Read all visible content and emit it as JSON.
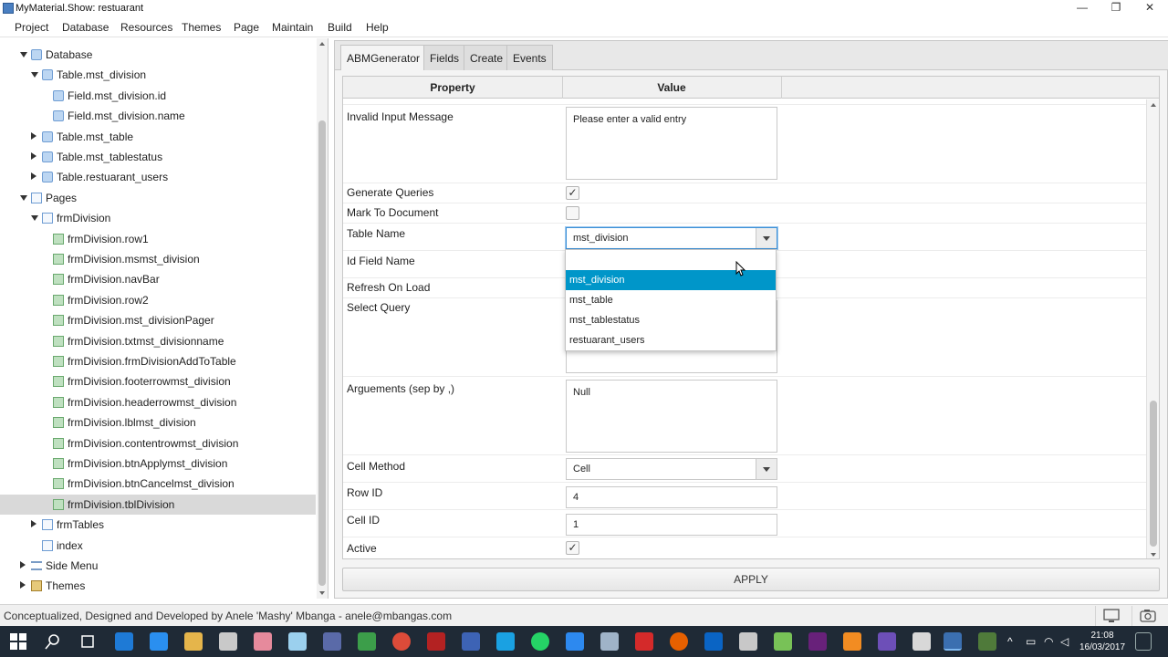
{
  "window": {
    "title": "MyMaterial.Show: restuarant",
    "minimize": "—",
    "maximize": "❐",
    "close": "✕"
  },
  "menu": [
    "Project",
    "Database",
    "Resources",
    "Themes",
    "Page",
    "Maintain",
    "Build",
    "Help"
  ],
  "tree": {
    "items": [
      {
        "label": "Database",
        "level": 1,
        "arrow": "down",
        "icon": "database-icon",
        "kind": "db"
      },
      {
        "label": "Table.mst_division",
        "level": 2,
        "arrow": "down",
        "icon": "table-icon",
        "kind": "db"
      },
      {
        "label": "Field.mst_division.id",
        "level": 3,
        "arrow": "",
        "icon": "field-icon",
        "kind": "db"
      },
      {
        "label": "Field.mst_division.name",
        "level": 3,
        "arrow": "",
        "icon": "field-icon",
        "kind": "db"
      },
      {
        "label": "Table.mst_table",
        "level": 2,
        "arrow": "right",
        "icon": "table-icon",
        "kind": "db"
      },
      {
        "label": "Table.mst_tablestatus",
        "level": 2,
        "arrow": "right",
        "icon": "table-icon",
        "kind": "db"
      },
      {
        "label": "Table.restuarant_users",
        "level": 2,
        "arrow": "right",
        "icon": "table-icon",
        "kind": "db"
      },
      {
        "label": "Pages",
        "level": 1,
        "arrow": "down",
        "icon": "pages-icon",
        "kind": "page"
      },
      {
        "label": "frmDivision",
        "level": 2,
        "arrow": "down",
        "icon": "page-icon",
        "kind": "page"
      },
      {
        "label": "frmDivision.row1",
        "level": 3,
        "arrow": "",
        "icon": "control-icon",
        "kind": "ctl"
      },
      {
        "label": "frmDivision.msmst_division",
        "level": 3,
        "arrow": "",
        "icon": "control-icon",
        "kind": "ctl"
      },
      {
        "label": "frmDivision.navBar",
        "level": 3,
        "arrow": "",
        "icon": "control-icon",
        "kind": "ctl"
      },
      {
        "label": "frmDivision.row2",
        "level": 3,
        "arrow": "",
        "icon": "control-icon",
        "kind": "ctl"
      },
      {
        "label": "frmDivision.mst_divisionPager",
        "level": 3,
        "arrow": "",
        "icon": "control-icon",
        "kind": "ctl"
      },
      {
        "label": "frmDivision.txtmst_divisionname",
        "level": 3,
        "arrow": "",
        "icon": "control-icon",
        "kind": "ctl"
      },
      {
        "label": "frmDivision.frmDivisionAddToTable",
        "level": 3,
        "arrow": "",
        "icon": "control-icon",
        "kind": "ctl"
      },
      {
        "label": "frmDivision.footerrowmst_division",
        "level": 3,
        "arrow": "",
        "icon": "control-icon",
        "kind": "ctl"
      },
      {
        "label": "frmDivision.headerrowmst_division",
        "level": 3,
        "arrow": "",
        "icon": "control-icon",
        "kind": "ctl"
      },
      {
        "label": "frmDivision.lblmst_division",
        "level": 3,
        "arrow": "",
        "icon": "control-icon",
        "kind": "ctl"
      },
      {
        "label": "frmDivision.contentrowmst_division",
        "level": 3,
        "arrow": "",
        "icon": "control-icon",
        "kind": "ctl"
      },
      {
        "label": "frmDivision.btnApplymst_division",
        "level": 3,
        "arrow": "",
        "icon": "control-icon",
        "kind": "ctl"
      },
      {
        "label": "frmDivision.btnCancelmst_division",
        "level": 3,
        "arrow": "",
        "icon": "control-icon",
        "kind": "ctl"
      },
      {
        "label": "frmDivision.tblDivision",
        "level": 3,
        "arrow": "",
        "icon": "control-icon",
        "kind": "ctl",
        "selected": true
      },
      {
        "label": "frmTables",
        "level": 2,
        "arrow": "right",
        "icon": "page-icon",
        "kind": "page"
      },
      {
        "label": "index",
        "level": 2,
        "arrow": "",
        "icon": "page-icon",
        "kind": "page"
      },
      {
        "label": "Side Menu",
        "level": 1,
        "arrow": "right",
        "icon": "menu-icon",
        "kind": "menu"
      },
      {
        "label": "Themes",
        "level": 1,
        "arrow": "right",
        "icon": "theme-icon",
        "kind": "theme"
      }
    ]
  },
  "tabs": [
    {
      "label": "ABMGenerator",
      "active": true
    },
    {
      "label": "Fields",
      "active": false
    },
    {
      "label": "Create",
      "active": false
    },
    {
      "label": "Events",
      "active": false
    }
  ],
  "grid": {
    "headers": {
      "property": "Property",
      "value": "Value"
    },
    "rows": {
      "invalid_input": {
        "label": "Invalid Input Message",
        "value": "Please enter a valid entry"
      },
      "generate_queries": {
        "label": "Generate Queries",
        "checked": true
      },
      "mark_to_document": {
        "label": "Mark To Document",
        "checked": false
      },
      "table_name": {
        "label": "Table Name",
        "value": "mst_division"
      },
      "id_field_name": {
        "label": "Id Field Name"
      },
      "refresh_on_load": {
        "label": "Refresh On Load"
      },
      "select_query": {
        "label": "Select Query"
      },
      "arguements": {
        "label": "Arguements (sep by ,)",
        "value": "Null"
      },
      "cell_method": {
        "label": "Cell Method",
        "value": "Cell"
      },
      "row_id": {
        "label": "Row ID",
        "value": "4"
      },
      "cell_id": {
        "label": "Cell ID",
        "value": "1"
      },
      "active": {
        "label": "Active",
        "checked": true
      }
    }
  },
  "dropdown": {
    "options": [
      "mst_division",
      "mst_table",
      "mst_tablestatus",
      "restuarant_users"
    ],
    "highlighted": "mst_division"
  },
  "apply_label": "APPLY",
  "status": {
    "text": "Conceptualized, Designed and Developed by Anele 'Mashy' Mbanga - anele@mbangas.com"
  },
  "clock": {
    "time": "21:08",
    "date": "16/03/2017"
  },
  "colors": {
    "highlight": "#0096c9",
    "taskbar": "#1f2a36"
  }
}
